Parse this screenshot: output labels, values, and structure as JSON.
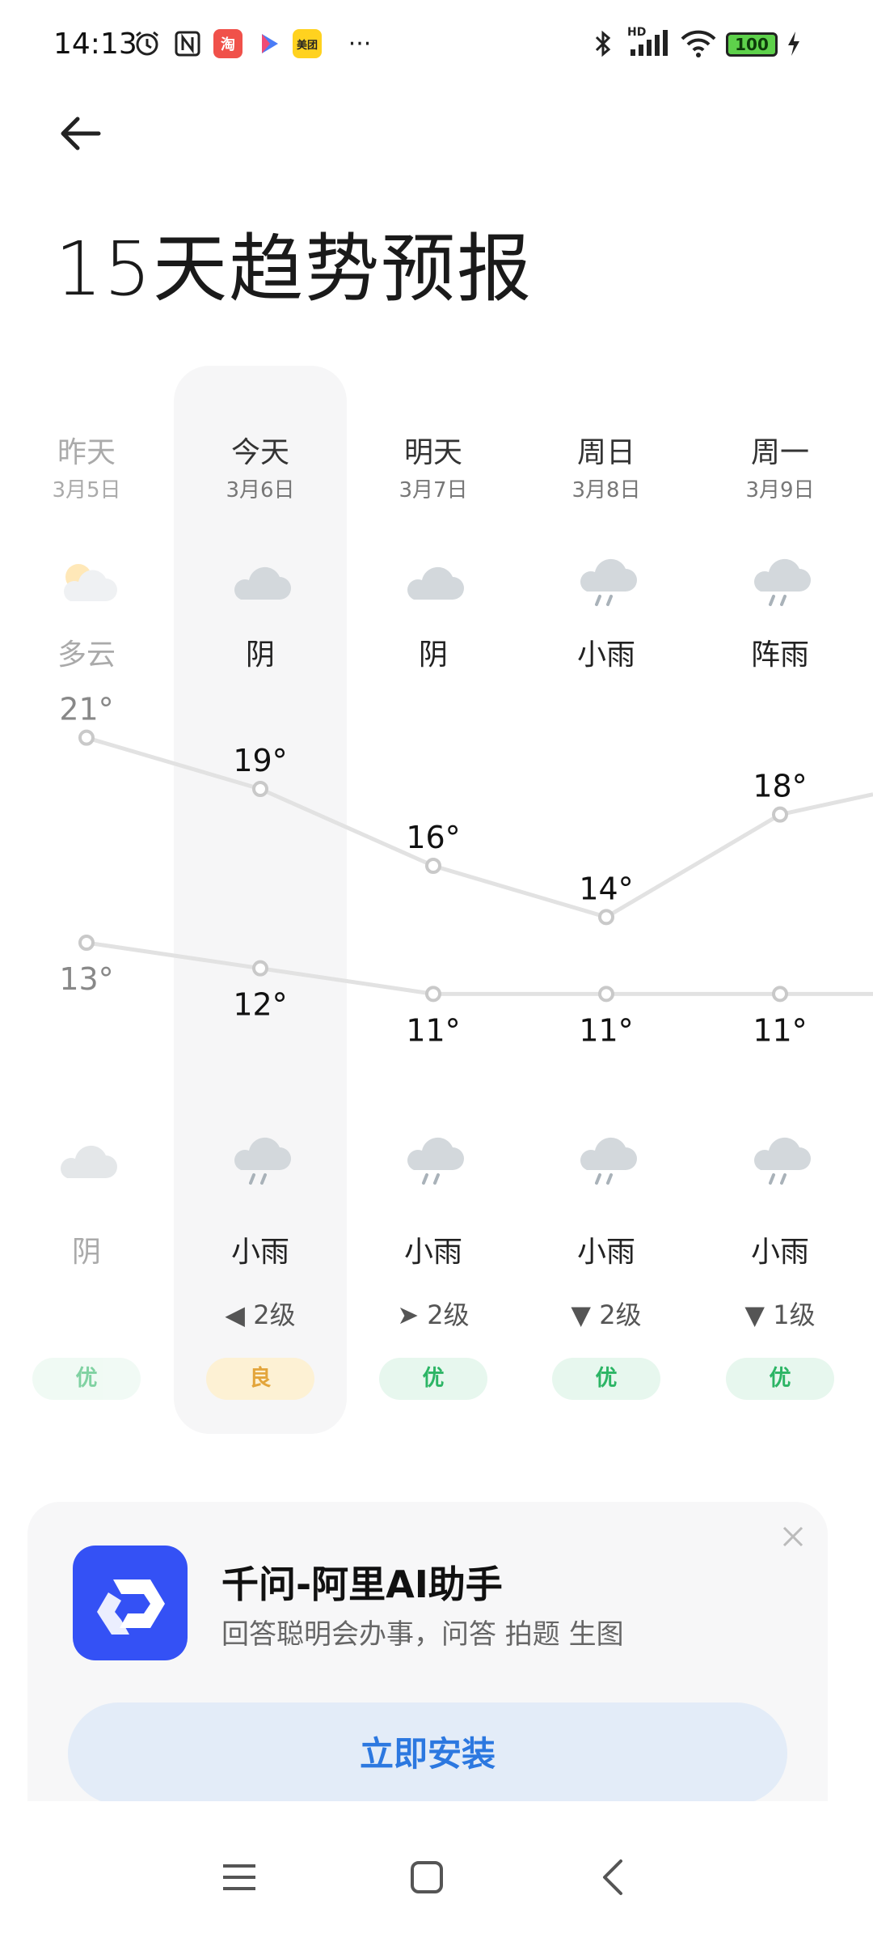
{
  "status_bar": {
    "time": "14:13",
    "left_icons": [
      "alarm-icon",
      "nfc-icon",
      "taobao-app-icon",
      "video-app-icon",
      "meituan-app-icon",
      "more-dots-icon"
    ],
    "taobao_label": "淘",
    "meituan_label": "美团",
    "more": "···",
    "right_icons": [
      "bluetooth-icon",
      "hd-signal-icon",
      "wifi-icon",
      "battery-icon",
      "charging-icon"
    ],
    "hd_label": "HD",
    "battery_level": "100"
  },
  "header": {
    "title": "15天趋势预报"
  },
  "forecast": {
    "days": [
      {
        "day": "昨天",
        "date": "3月5日",
        "day_condition": "多云",
        "day_icon": "partly-cloudy-icon",
        "high": "21°",
        "low": "13°",
        "night_condition": "阴",
        "night_icon": "cloudy-icon",
        "wind": "",
        "aqi": "优",
        "aqi_level": "good",
        "past": true
      },
      {
        "day": "今天",
        "date": "3月6日",
        "day_condition": "阴",
        "day_icon": "cloudy-icon",
        "high": "19°",
        "low": "12°",
        "night_condition": "小雨",
        "night_icon": "light-rain-icon",
        "wind": "◀ 2级",
        "aqi": "良",
        "aqi_level": "fair",
        "past": false
      },
      {
        "day": "明天",
        "date": "3月7日",
        "day_condition": "阴",
        "day_icon": "cloudy-icon",
        "high": "16°",
        "low": "11°",
        "night_condition": "小雨",
        "night_icon": "light-rain-icon",
        "wind": "➤ 2级",
        "aqi": "优",
        "aqi_level": "good",
        "past": false
      },
      {
        "day": "周日",
        "date": "3月8日",
        "day_condition": "小雨",
        "day_icon": "light-rain-icon",
        "high": "14°",
        "low": "11°",
        "night_condition": "小雨",
        "night_icon": "light-rain-icon",
        "wind": "▼ 2级",
        "aqi": "优",
        "aqi_level": "good",
        "past": false
      },
      {
        "day": "周一",
        "date": "3月9日",
        "day_condition": "阵雨",
        "day_icon": "shower-icon",
        "high": "18°",
        "low": "11°",
        "night_condition": "小雨",
        "night_icon": "light-rain-icon",
        "wind": "▼ 1级",
        "aqi": "优",
        "aqi_level": "good",
        "past": false
      }
    ]
  },
  "chart_data": {
    "type": "line",
    "categories": [
      "昨天",
      "今天",
      "明天",
      "周日",
      "周一"
    ],
    "series": [
      {
        "values": [
          21,
          19,
          16,
          14,
          18
        ]
      },
      {
        "values": [
          13,
          12,
          11,
          11,
          11
        ]
      }
    ],
    "high_labels": [
      "21°",
      "19°",
      "16°",
      "14°",
      "18°"
    ],
    "low_labels": [
      "13°",
      "12°",
      "11°",
      "11°",
      "11°"
    ],
    "line_color": "#e2e2e2"
  },
  "ad": {
    "app_name": "千问-阿里AI助手",
    "description": "回答聪明会办事，问答 拍题 生图",
    "install_label": "立即安装",
    "close_icon": "close-icon",
    "logo_icon": "qianwen-logo-icon",
    "brand_color": "#3451f5",
    "button_text_color": "#2c78e0"
  },
  "nav_bar": {
    "icons": [
      "menu-icon",
      "home-icon",
      "back-icon"
    ]
  },
  "colors": {
    "aqi_good": "#2cb565",
    "aqi_fair": "#e3a53b",
    "today_column_bg": "#f6f6f7"
  }
}
